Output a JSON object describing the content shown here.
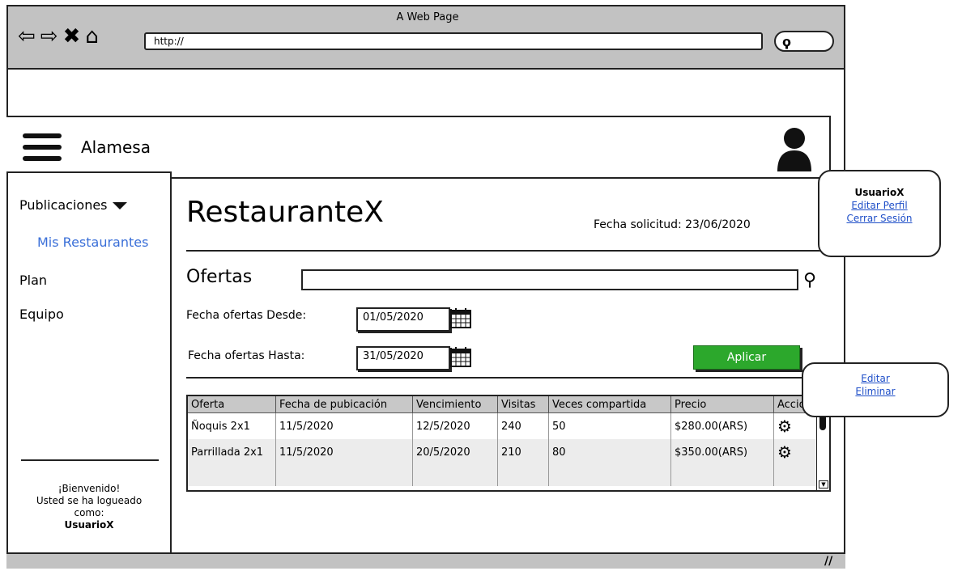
{
  "browser": {
    "title": "A Web Page",
    "url": "http://",
    "nav_icons": [
      "back-arrow-icon",
      "forward-arrow-icon",
      "close-x-icon",
      "home-icon"
    ]
  },
  "app": {
    "brand": "Alamesa"
  },
  "sidebar": {
    "items": [
      {
        "label": "Publicaciones"
      },
      {
        "label": "Mis Restaurantes"
      },
      {
        "label": "Plan"
      },
      {
        "label": "Equipo"
      }
    ],
    "welcome": {
      "line1": "¡Bienvenido!",
      "line2": "Usted se ha logueado",
      "line3": "como:",
      "user": "UsuarioX"
    }
  },
  "main": {
    "title": "RestauranteX",
    "fecha_solicitud": "Fecha solicitud: 23/06/2020",
    "ofertas_label": "Ofertas",
    "search_value": "",
    "desde_label": "Fecha ofertas Desde:",
    "desde_value": "01/05/2020",
    "hasta_label": "Fecha ofertas Hasta:",
    "hasta_value": "31/05/2020",
    "apply_label": "Aplicar"
  },
  "table": {
    "headers": [
      "Oferta",
      "Fecha de pubicación",
      "Vencimiento",
      "Visitas",
      "Veces compartida",
      "Precio",
      "Accio"
    ],
    "rows": [
      [
        "Ñoquis 2x1",
        "11/5/2020",
        "12/5/2020",
        "240",
        "50",
        "$280.00(ARS)"
      ],
      [
        "Parrillada 2x1",
        "11/5/2020",
        "20/5/2020",
        "210",
        "80",
        "$350.00(ARS)"
      ]
    ]
  },
  "user_menu": {
    "user": "UsuarioX",
    "edit": "Editar Perfil",
    "logout": "Cerrar Sesión"
  },
  "row_menu": {
    "edit": "Editar",
    "delete": "Eliminar"
  },
  "colors": {
    "apply_button": "#2ca82c",
    "link": "#1f4fc8",
    "chrome": "#c2c2c2"
  }
}
